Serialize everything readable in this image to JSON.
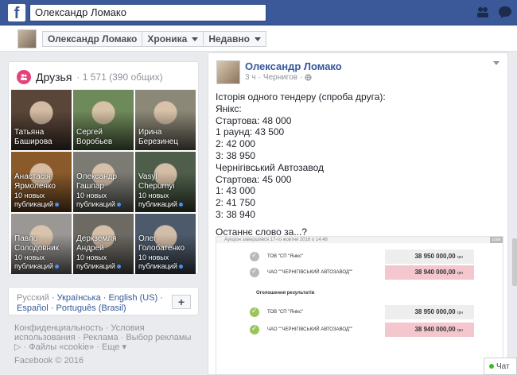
{
  "topbar": {
    "logo": "f",
    "search_value": "Олександр Ломако"
  },
  "subnav": {
    "name": "Олександр Ломако",
    "timeline": "Хроника",
    "recent": "Недавно"
  },
  "friends": {
    "title": "Друзья",
    "count": "· 1 571 (390 общих)",
    "items": [
      {
        "name": "Татьяна Баширова",
        "posts": "",
        "bg": "#5a4638"
      },
      {
        "name": "Сергей Воробьев",
        "posts": "",
        "bg": "#6f8a5a"
      },
      {
        "name": "Ирина Березинец",
        "posts": "",
        "bg": "#8c8877"
      },
      {
        "name": "Анастасія Ярмоленко",
        "posts": "10 новых публикаций",
        "bg": "#8a5a2b"
      },
      {
        "name": "Олександр Гашпар",
        "posts": "10 новых публикаций",
        "bg": "#7b7b74"
      },
      {
        "name": "Vasyl Chepurnyi",
        "posts": "10 новых публикаций",
        "bg": "#4f5e4a"
      },
      {
        "name": "Павло Солодовник",
        "posts": "10 новых публикаций",
        "bg": "#9a9794"
      },
      {
        "name": "Деркземля Андрей",
        "posts": "10 новых публикаций",
        "bg": "#6d6a64"
      },
      {
        "name": "Олег Голобатенко",
        "posts": "10 новых публикаций",
        "bg": "#4d5a6b"
      }
    ]
  },
  "languages": {
    "current": "Русский",
    "others": "Українська · English (US) · Español · Português (Brasil)",
    "add": "+"
  },
  "footer": {
    "links": "Конфиденциальность · Условия использования · Реклама · Выбор рекламы ▷ · Файлы «cookie» · Еще ▾",
    "copyright": "Facebook © 2016"
  },
  "post": {
    "author": "Олександр Ломако",
    "time": "3 ч",
    "place": "Чернигов",
    "lines": [
      "Історія одного тендеру (спроба друга):",
      "Янікс:",
      "Стартова: 48 000",
      "1 раунд: 43 500",
      "2: 42 000",
      "3: 38 950",
      "Чернігівський Автозавод",
      "Стартова: 45 000",
      "1: 43 000",
      "2: 41 750",
      "3: 38 940"
    ],
    "closing": "Останнє слово за...?",
    "shot": {
      "header": "Аукціон завершився 17-го жовтня 2016 о 14:48",
      "tag": "code",
      "subtitle": "Оголошення результатів",
      "bids": [
        {
          "name": "ТОВ \"СП \"Янікс\"",
          "amount": "38 950 000,00",
          "unit": "грн",
          "red": false,
          "ok": false
        },
        {
          "name": "ЧАО \"\"ЧЕРНІГІВСЬКИЙ АВТОЗАВОД\"\"",
          "amount": "38 940 000,00",
          "unit": "грн",
          "red": true,
          "ok": false
        },
        {
          "name": "ТОВ \"СП \"Янікс\"",
          "amount": "38 950 000,00",
          "unit": "грн",
          "red": false,
          "ok": true
        },
        {
          "name": "ЧАО \"\"ЧЕРНІГІВСЬКИЙ АВТОЗАВОД\"\"",
          "amount": "38 940 000,00",
          "unit": "грн",
          "red": true,
          "ok": true
        }
      ]
    }
  },
  "chat": {
    "label": "Чат"
  },
  "colors": {
    "brand": "#3b5998",
    "link": "#365899",
    "friends_icon": "#e5427a"
  },
  "icons": [
    "facebook-logo-icon",
    "search-icon",
    "friends-requests-icon",
    "messages-icon",
    "friends-icon",
    "globe-icon",
    "chevron-down-icon",
    "check-icon",
    "online-dot-icon"
  ]
}
